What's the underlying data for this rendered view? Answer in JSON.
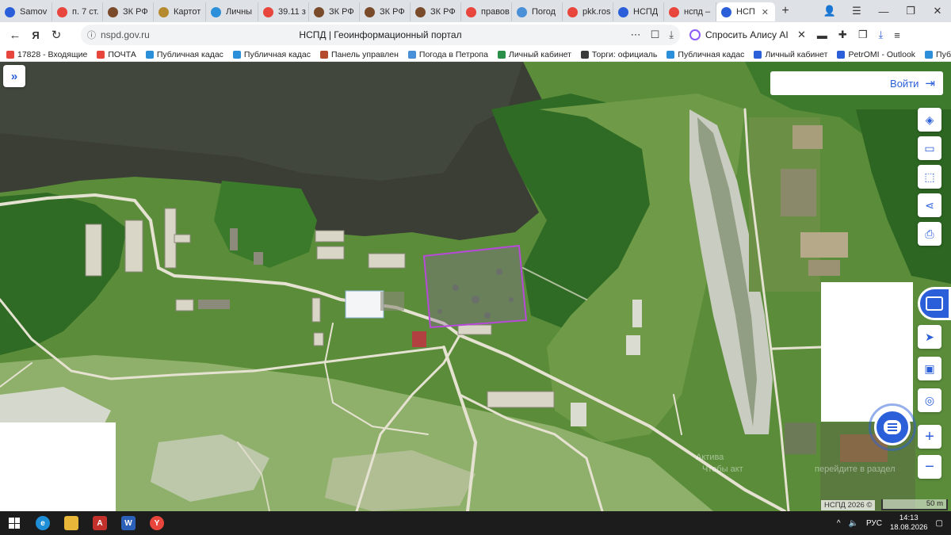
{
  "browser": {
    "tabs": [
      {
        "label": "Samov",
        "icon": "samovar-icon",
        "color": "#2b5fd9",
        "active": false,
        "close": false
      },
      {
        "label": "п. 7 ст.",
        "icon": "yandex-icon",
        "color": "#e8453c",
        "active": false,
        "close": false
      },
      {
        "label": "ЗК РФ",
        "icon": "consultant-icon",
        "color": "#7a4b2a",
        "active": false,
        "close": false
      },
      {
        "label": "Картот",
        "icon": "emblem-icon",
        "color": "#b58a2e",
        "active": false,
        "close": false
      },
      {
        "label": "Личны",
        "icon": "rosreestr-icon",
        "color": "#2b8fd9",
        "active": false,
        "close": false
      },
      {
        "label": "39.11 з",
        "icon": "yandex-icon",
        "color": "#e8453c",
        "active": false,
        "close": false
      },
      {
        "label": "ЗК РФ",
        "icon": "consultant-icon",
        "color": "#7a4b2a",
        "active": false,
        "close": false
      },
      {
        "label": "ЗК РФ",
        "icon": "consultant-icon",
        "color": "#7a4b2a",
        "active": false,
        "close": false
      },
      {
        "label": "ЗК РФ",
        "icon": "consultant-icon",
        "color": "#7a4b2a",
        "active": false,
        "close": false
      },
      {
        "label": "правов",
        "icon": "yandex-icon",
        "color": "#e8453c",
        "active": false,
        "close": false
      },
      {
        "label": "Погод",
        "icon": "weather-icon",
        "color": "#4a90d9",
        "active": false,
        "close": false
      },
      {
        "label": "pkk.ros",
        "icon": "yandex-icon",
        "color": "#e8453c",
        "active": false,
        "close": false
      },
      {
        "label": "НСПД",
        "icon": "nspd-icon",
        "color": "#2b5fd9",
        "active": false,
        "close": false
      },
      {
        "label": "нспд –",
        "icon": "yandex-icon",
        "color": "#e8453c",
        "active": false,
        "close": false
      },
      {
        "label": "НСП",
        "icon": "nspd-icon",
        "color": "#2b5fd9",
        "active": true,
        "close": true
      }
    ],
    "new_tab": "+",
    "url": "nspd.gov.ru",
    "page_title": "НСПД | Геоинформационный портал",
    "alice_label": "Спросить Алису AI"
  },
  "bookmarks": [
    {
      "label": "17828 - Входящие",
      "color": "#e8453c"
    },
    {
      "label": "ПОЧТА",
      "color": "#e8453c"
    },
    {
      "label": "Публичная кадас",
      "color": "#2b8fd9"
    },
    {
      "label": "Публичная кадас",
      "color": "#2b8fd9"
    },
    {
      "label": "Панель управлен",
      "color": "#b44b2e"
    },
    {
      "label": "Погода в Петропа",
      "color": "#4a90d9"
    },
    {
      "label": "Личный кабинет",
      "color": "#2b8f4a"
    },
    {
      "label": "Торги: официаль",
      "color": "#3a3a3a"
    },
    {
      "label": "Публичная кадас",
      "color": "#2b8fd9"
    },
    {
      "label": "Личный кабинет",
      "color": "#2b5fd9"
    },
    {
      "label": "PetrOMI - Outlook",
      "color": "#2b5fd9"
    },
    {
      "label": "Публичная ка",
      "color": "#2b8fd9"
    }
  ],
  "map": {
    "login_label": "Войти",
    "watermark_line1": "Актива",
    "watermark_line2": "Чтобы акт",
    "watermark_line3": "перейдите в раздел",
    "copyright": "НСПД 2026 ©",
    "scale_label": "50 m",
    "plot_color": "#b84ad9"
  },
  "taskbar": {
    "lang": "РУС",
    "time": "14:13",
    "date": "18.08.2026"
  }
}
